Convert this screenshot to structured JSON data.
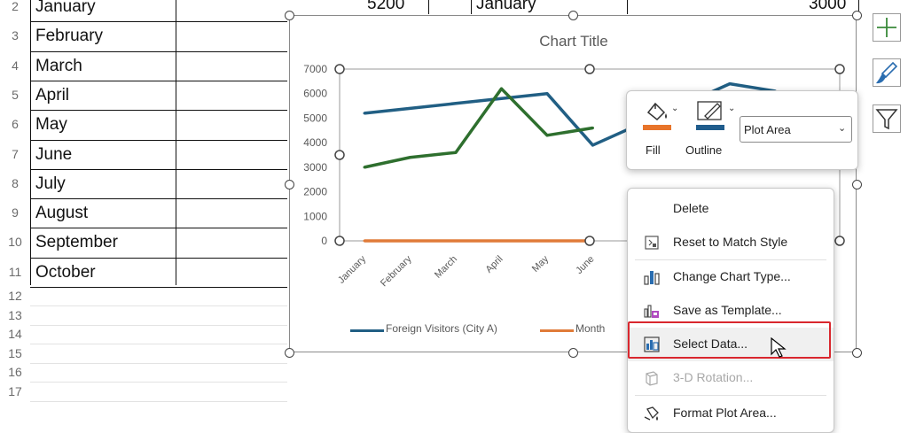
{
  "sheet": {
    "rows": [
      {
        "num": "2",
        "month": "January"
      },
      {
        "num": "3",
        "month": "February"
      },
      {
        "num": "4",
        "month": "March"
      },
      {
        "num": "5",
        "month": "April"
      },
      {
        "num": "6",
        "month": "May"
      },
      {
        "num": "7",
        "month": "June"
      },
      {
        "num": "8",
        "month": "July"
      },
      {
        "num": "9",
        "month": "August"
      },
      {
        "num": "10",
        "month": "September"
      },
      {
        "num": "11",
        "month": "October"
      },
      {
        "num": "12",
        "month": ""
      },
      {
        "num": "13",
        "month": ""
      },
      {
        "num": "14",
        "month": ""
      },
      {
        "num": "15",
        "month": ""
      },
      {
        "num": "16",
        "month": ""
      },
      {
        "num": "17",
        "month": ""
      }
    ],
    "row2_value_b": "5200",
    "row2_month_d": "January",
    "row2_value_e": "3000"
  },
  "chart": {
    "title": "Chart Title",
    "y_ticks": [
      "7000",
      "6000",
      "5000",
      "4000",
      "3000",
      "2000",
      "1000",
      "0"
    ],
    "legend": [
      "Foreign Visitors (City A)",
      "Month"
    ]
  },
  "chart_data": {
    "type": "line",
    "title": "Chart Title",
    "categories": [
      "January",
      "February",
      "March",
      "April",
      "May",
      "June"
    ],
    "ylim": [
      0,
      7000
    ],
    "series": [
      {
        "name": "Foreign Visitors (City A)",
        "color": "#215f84",
        "values": [
          5200,
          5400,
          5600,
          5800,
          6000,
          3900
        ],
        "extra_visible": [
          6400,
          6100
        ]
      },
      {
        "name": "Month",
        "color": "#e07b39",
        "values": [
          0,
          0,
          0,
          0,
          0,
          0
        ]
      },
      {
        "name": "",
        "color": "#2e6f2e",
        "values": [
          3000,
          3400,
          3600,
          6200,
          4300,
          4600
        ]
      }
    ]
  },
  "format_popup": {
    "fill_label": "Fill",
    "outline_label": "Outline",
    "dropdown_value": "Plot Area",
    "fill_color": "#e8742a",
    "outline_color": "#1f5c8c"
  },
  "context_menu": {
    "items": [
      {
        "label": "Delete",
        "icon": "none"
      },
      {
        "label": "Reset to Match Style",
        "icon": "reset-style-icon"
      },
      {
        "label": "Change Chart Type...",
        "icon": "chart-type-icon"
      },
      {
        "label": "Save as Template...",
        "icon": "template-icon"
      },
      {
        "label": "Select Data...",
        "icon": "select-data-icon"
      },
      {
        "label": "3-D Rotation...",
        "icon": "rotation-3d-icon",
        "disabled": true
      },
      {
        "label": "Format Plot Area...",
        "icon": "format-plot-area-icon"
      }
    ],
    "highlight_color": "#d9272e"
  },
  "side_buttons": [
    "chart-elements-icon",
    "chart-styles-icon",
    "chart-filters-icon"
  ]
}
